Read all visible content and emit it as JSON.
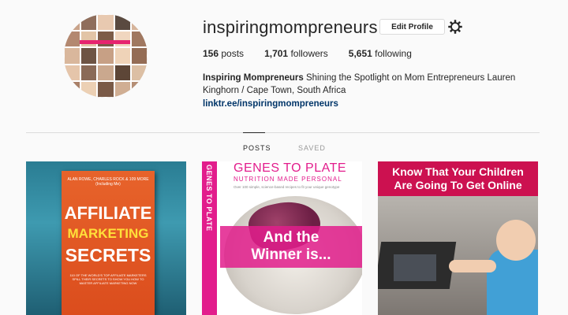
{
  "profile": {
    "username": "inspiringmompreneurs",
    "edit_button": "Edit Profile",
    "settings_icon": "gear-icon"
  },
  "stats": {
    "posts_count": "156",
    "posts_label": "posts",
    "followers_count": "1,701",
    "followers_label": "followers",
    "following_count": "5,651",
    "following_label": "following"
  },
  "bio": {
    "full_name": "Inspiring Mompreneurs",
    "text": " Shining the Spotlight on Mom Entrepreneurs Lauren Kinghorn / Cape Town, South Africa",
    "link": "linktr.ee/inspiringmompreneurs"
  },
  "tabs": [
    {
      "label": "POSTS",
      "active": true
    },
    {
      "label": "SAVED",
      "active": false
    }
  ],
  "posts": [
    {
      "authors": "ALAN ROWE, CHARLES ROCK & 109 MORE",
      "including": "(Including Me)",
      "title_line1": "AFFILIATE",
      "title_line2": "MARKETING",
      "title_line3": "SECRETS",
      "subtitle": "110 OF THE WORLD'S TOP AFFILIATE MARKETERS SPILL THEIR SECRETS TO SHOW YOU HOW TO MASTER AFFILIATE MARKETING NOW"
    },
    {
      "spine_text": "GENES TO PLATE",
      "title": "GENES TO PLATE",
      "subtitle": "NUTRITION MADE PERSONAL",
      "tagline": "Over 100 simple, science-based recipes to fit your unique genotype",
      "overlay_line1": "And the",
      "overlay_line2": "Winner is..."
    },
    {
      "headline_line1": "Know That Your Children",
      "headline_line2": "Are Going To Get Online"
    }
  ],
  "colors": {
    "brand_pink": "#e21d8c",
    "link_blue": "#003569",
    "headline_red": "#cc1150"
  }
}
